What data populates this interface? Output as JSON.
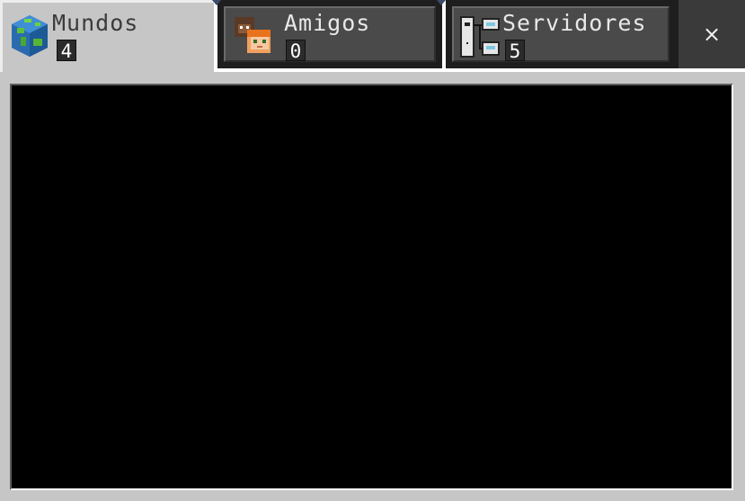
{
  "tabs": [
    {
      "label": "Mundos",
      "count": "4",
      "icon": "globe-icon",
      "active": true
    },
    {
      "label": "Amigos",
      "count": "0",
      "icon": "friends-icon",
      "active": false
    },
    {
      "label": "Servidores",
      "count": "5",
      "icon": "server-icon",
      "active": false
    }
  ],
  "close_label": "×",
  "colors": {
    "panel": "#c6c6c6",
    "inactive_tab": "#4a4a4a",
    "content": "#000000"
  }
}
